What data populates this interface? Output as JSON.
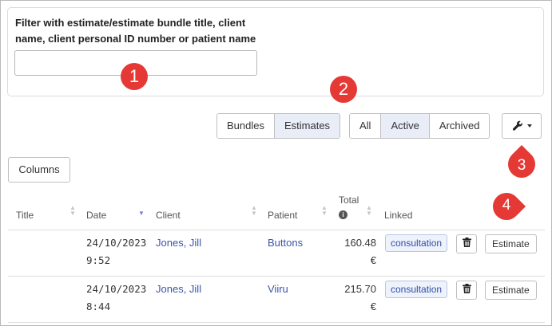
{
  "filter": {
    "label": "Filter with estimate/estimate bundle title, client name, client personal ID number or patient name",
    "value": "",
    "placeholder": ""
  },
  "markers": [
    "1",
    "2",
    "3",
    "4"
  ],
  "view_toggle": {
    "bundles": "Bundles",
    "estimates": "Estimates",
    "selected": "Estimates"
  },
  "status_toggle": {
    "all": "All",
    "active": "Active",
    "archived": "Archived",
    "selected": "Active"
  },
  "tools_icon": "wrench-icon",
  "columns_button": "Columns",
  "table": {
    "headers": {
      "title": "Title",
      "date": "Date",
      "client": "Client",
      "patient": "Patient",
      "total": "Total",
      "linked": "Linked"
    },
    "rows": [
      {
        "date": "24/10/2023",
        "time": "9:52",
        "client": "Jones, Jill",
        "patient": "Buttons",
        "total": "160.48",
        "currency": "€",
        "linked": "consultation",
        "action": "Estimate"
      },
      {
        "date": "24/10/2023",
        "time": "8:44",
        "client": "Jones, Jill",
        "patient": "Viiru",
        "total": "215.70",
        "currency": "€",
        "linked": "consultation",
        "action": "Estimate"
      }
    ]
  },
  "colors": {
    "accent": "#e53935",
    "link": "#3c55a8",
    "active_bg": "#e8edf8"
  }
}
